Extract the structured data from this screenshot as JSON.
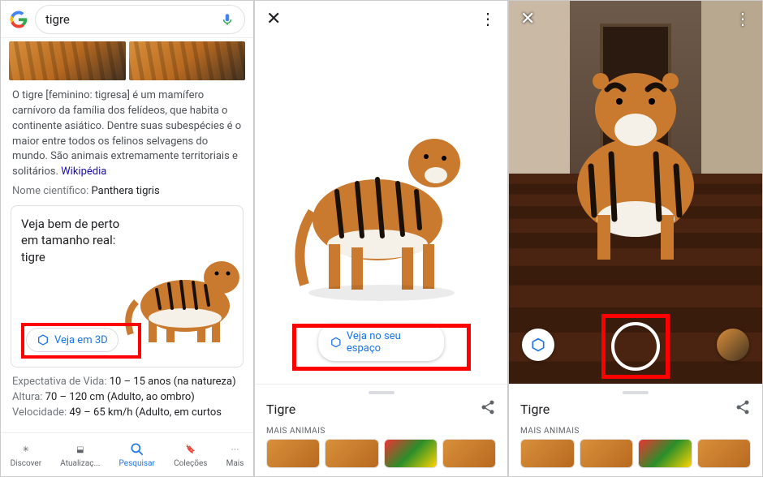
{
  "panel1": {
    "search_query": "tigre",
    "description": "O tigre [feminino: tigresa] é um mamífero carnívoro da família dos felídeos, que habita o continente asiático. Dentre suas subespécies é o maior entre todos os felinos selvagens do mundo. São animais extremamente territoriais e solitários.",
    "wiki_label": "Wikipédia",
    "sci_name_label": "Nome científico:",
    "sci_name_value": "Panthera tigris",
    "card_title": "Veja bem de perto em tamanho real: tigre",
    "veja3d_label": "Veja em 3D",
    "facts": [
      {
        "label": "Expectativa de Vida:",
        "value": "10 – 15 anos (na natureza)"
      },
      {
        "label": "Altura:",
        "value": "70 – 120 cm (Adulto, ao ombro)"
      },
      {
        "label": "Velocidade:",
        "value": "49 – 65 km/h (Adulto, em curtos"
      }
    ],
    "bottombar": [
      {
        "icon": "sparkle-icon",
        "label": "Discover"
      },
      {
        "icon": "inbox-icon",
        "label": "Atualizaç..."
      },
      {
        "icon": "search-icon",
        "label": "Pesquisar"
      },
      {
        "icon": "bookmark-icon",
        "label": "Coleções"
      },
      {
        "icon": "more-icon",
        "label": "Mais"
      }
    ]
  },
  "panel2": {
    "veja_espaco_label": "Veja no seu espaço",
    "sheet_title": "Tigre",
    "more_label": "MAIS ANIMAIS"
  },
  "panel3": {
    "sheet_title": "Tigre",
    "more_label": "MAIS ANIMAIS"
  },
  "colors": {
    "google_blue": "#1a73e8",
    "highlight_red": "#ff0000"
  }
}
